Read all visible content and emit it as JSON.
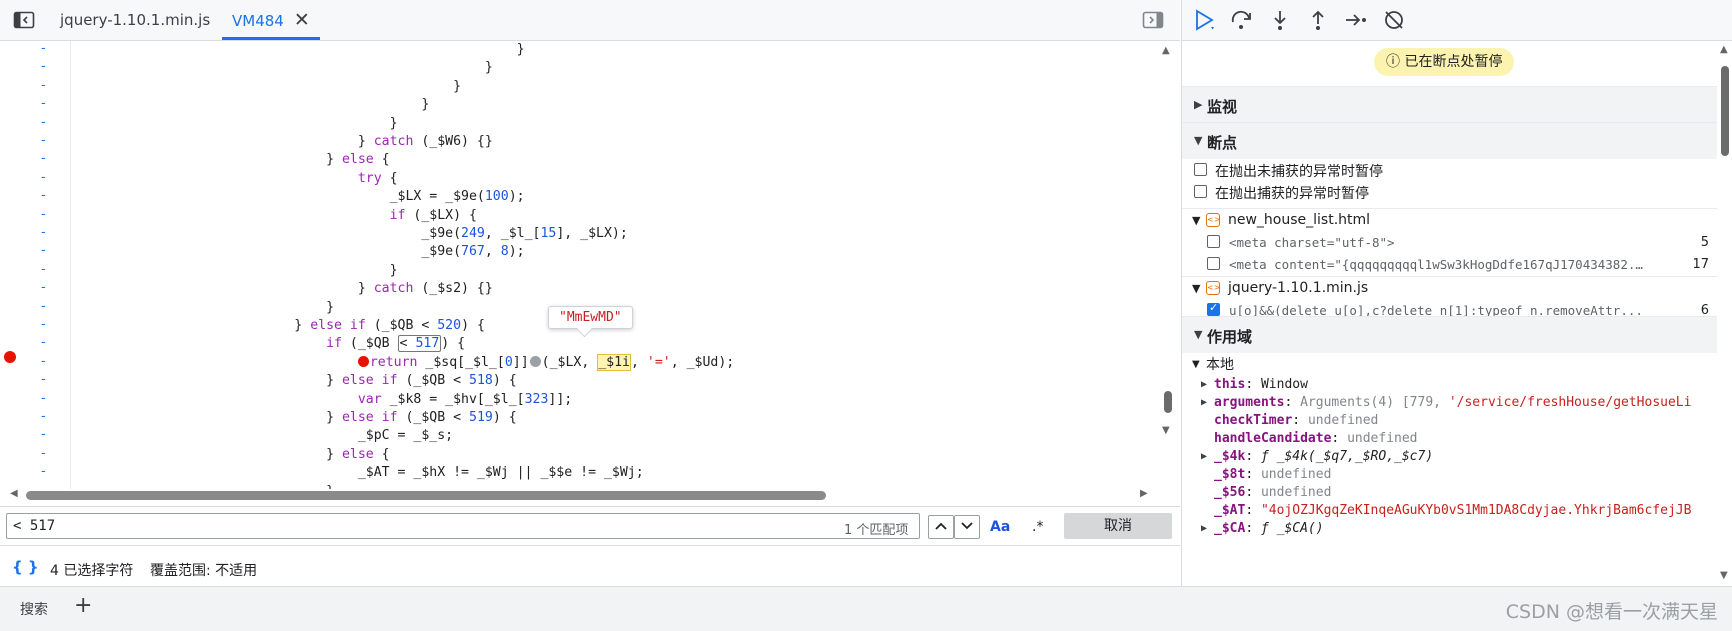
{
  "tabs": [
    {
      "label": "jquery-1.10.1.min.js",
      "active": false
    },
    {
      "label": "VM484",
      "active": true,
      "close": "✕"
    }
  ],
  "code_lines": [
    {
      "html": "                                                        }"
    },
    {
      "html": "                                                    }"
    },
    {
      "html": "                                                }"
    },
    {
      "html": "                                            }"
    },
    {
      "html": "                                        }"
    },
    {
      "html": "                                    } <span class=\"kw\">catch</span> (_$W6) {}"
    },
    {
      "html": "                                } <span class=\"kw\">else</span> {"
    },
    {
      "html": "                                    <span class=\"kw\">try</span> {"
    },
    {
      "html": "                                        _$LX = _$9e(<span class=\"num\">100</span>);"
    },
    {
      "html": "                                        <span class=\"kw\">if</span> (_$LX) {"
    },
    {
      "html": "                                            _$9e(<span class=\"num\">249</span>, _$l_[<span class=\"num\">15</span>], _$LX);"
    },
    {
      "html": "                                            _$9e(<span class=\"num\">767</span>, <span class=\"num\">8</span>);"
    },
    {
      "html": "                                        }"
    },
    {
      "html": "                                    } <span class=\"kw\">catch</span> (_$s2) {}"
    },
    {
      "html": "                                }"
    },
    {
      "html": "                            } <span class=\"kw\">else if</span> (_$QB &lt; <span class=\"num\">520</span>) {"
    },
    {
      "html": "                                <span class=\"kw\">if</span> (_$QB <span class=\"hlbox\">&lt; <span class=\"num\">517</span></span>) {"
    },
    {
      "html": "                                    <span class=\"bpdot\"></span><span class=\"kw\">return</span> _$sq[_$l_[<span class=\"num\">0</span>]]<span class=\"greydot\"></span>(_$LX, <span class=\"hlvar\">_$1i</span>, <span class=\"str\">'='</span>, _$Ud);"
    },
    {
      "html": "                                } <span class=\"kw\">else if</span> (_$QB &lt; <span class=\"num\">518</span>) {"
    },
    {
      "html": "                                    <span class=\"kw\">var</span> _$k8 = _$hv[_$l_[<span class=\"num\">323</span>]];"
    },
    {
      "html": "                                } <span class=\"kw\">else if</span> (_$QB &lt; <span class=\"num\">519</span>) {"
    },
    {
      "html": "                                    _$pC = _$_s;"
    },
    {
      "html": "                                } <span class=\"kw\">else</span> {"
    },
    {
      "html": "                                    _$AT = _$hX != _$Wj || _$$e != _$Wj;"
    },
    {
      "html": "                                }"
    }
  ],
  "gutter_mark": "-",
  "tooltip_value": "\"MmEwMD\"",
  "search": {
    "query": "< 517",
    "match_count": "1 个匹配项",
    "case_label": "Aa",
    "regex_label": ".*",
    "cancel_label": "取消"
  },
  "status": {
    "braces": "{ }",
    "selection": "4 已选择字符",
    "coverage": "覆盖范围: 不适用"
  },
  "drawer": {
    "search_tab": "搜索",
    "add": "+",
    "watermark": "CSDN @想看一次满天星"
  },
  "debugger": {
    "paused_banner": "已在断点处暂停",
    "sections": {
      "watch": "监视",
      "breakpoints": "断点",
      "scope": "作用域"
    },
    "exception_options": [
      {
        "label": "在抛出未捕获的异常时暂停",
        "checked": false
      },
      {
        "label": "在抛出捕获的异常时暂停",
        "checked": false
      }
    ],
    "breakpoint_files": [
      {
        "name": "new_house_list.html",
        "items": [
          {
            "code": "<meta charset=\"utf-8\">",
            "line": "5",
            "checked": false
          },
          {
            "code": "<meta content=\"{qqqqqqqqql1wSw3kHogDdfe167qJ170434382...",
            "line": "17",
            "checked": false
          }
        ]
      },
      {
        "name": "jquery-1.10.1.min.js",
        "items": [
          {
            "code": "u[o]&&(delete u[o],c?delete n[1]:typeof n.removeAttr...",
            "line": "6",
            "checked": true
          }
        ]
      }
    ],
    "scope": {
      "local_label": "本地",
      "vars": [
        {
          "name": "this",
          "value": "Window",
          "kind": "plain",
          "expandable": true
        },
        {
          "name": "arguments",
          "value": "Arguments(4) [779, ",
          "extra": "'/service/freshHouse/getHosueLi",
          "kind": "args",
          "expandable": true
        },
        {
          "name": "checkTimer",
          "value": "undefined",
          "kind": "undef",
          "expandable": false
        },
        {
          "name": "handleCandidate",
          "value": "undefined",
          "kind": "undef",
          "expandable": false
        },
        {
          "name": "_$4k",
          "value": "ƒ _$4k(_$q7,_$RO,_$c7)",
          "kind": "func",
          "expandable": true
        },
        {
          "name": "_$8t",
          "value": "undefined",
          "kind": "undef",
          "expandable": false
        },
        {
          "name": "_$56",
          "value": "undefined",
          "kind": "undef",
          "expandable": false
        },
        {
          "name": "_$AT",
          "value": "\"4ojOZJKgqZeKInqeAGuKYb0vS1Mm1DA8Cdyjae.YhkrjBam6cfejJB",
          "kind": "str",
          "expandable": false
        },
        {
          "name": "_$CA",
          "value": "ƒ _$CA()",
          "kind": "func",
          "expandable": true
        }
      ]
    }
  }
}
